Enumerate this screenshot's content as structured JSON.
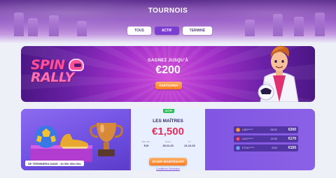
{
  "header": {
    "title": "TOURNOIS",
    "tabs": [
      {
        "label": "TOUS",
        "active": false
      },
      {
        "label": "ACTIF",
        "active": true
      },
      {
        "label": "TERMINÉ",
        "active": false
      }
    ]
  },
  "banner": {
    "logo_line1": "SPIN",
    "logo_line2": "RALLY",
    "headline": "GAGNEZ JUSQU'À",
    "amount": "€200",
    "cta": "PARTICIPER"
  },
  "tournament": {
    "countdown": "SE TERMINERA DANS : 1d 00h 30m 54s",
    "badge": "ACTIF",
    "title": "LES MAÎTRES",
    "prize": "€1,500",
    "stats": [
      {
        "label": "Mise Min.",
        "value": "€10"
      },
      {
        "label": "Début",
        "value": "25.11.23"
      },
      {
        "label": "Fin",
        "value": "21.12.23"
      }
    ],
    "cta": "JOUER MAINTENANT",
    "conditions": "Conditions Générales"
  },
  "leaderboard": [
    {
      "rank": "1",
      "name": "LABI******",
      "points": "28232",
      "prize": "€200",
      "color": "#f08a2a"
    },
    {
      "rank": "2",
      "name": "ILAS******",
      "points": "19149",
      "prize": "€170",
      "color": "#e0305a"
    },
    {
      "rank": "3",
      "name": "ETHA******",
      "points": "6334",
      "prize": "€150",
      "color": "#5a8cf0"
    }
  ],
  "colors": {
    "accent": "#7a3fd0",
    "cta": "#ff7a1e",
    "prize": "#e0305a"
  }
}
